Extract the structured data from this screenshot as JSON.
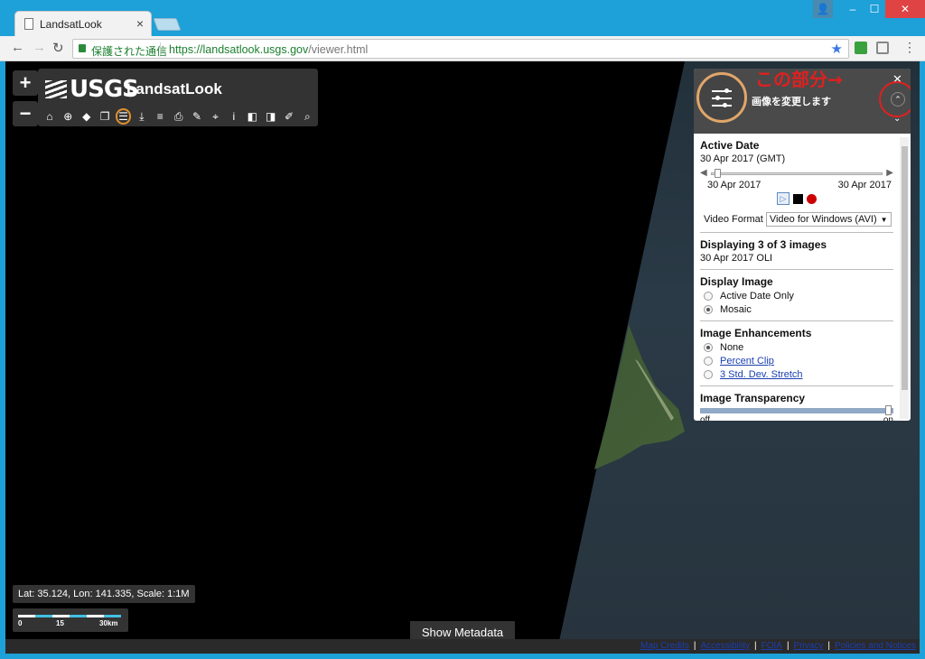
{
  "browser": {
    "tab_title": "LandsatLook",
    "tab_close": "×",
    "secure_label": "保護された通信",
    "url_host": "https://landsatlook.usgs.gov",
    "url_path": "/viewer.html",
    "back": "←",
    "forward": "→",
    "reload": "↻",
    "star": "★",
    "menu": "⋮",
    "win_user": "👤",
    "win_min": "–",
    "win_max": "☐",
    "win_close": "✕"
  },
  "map": {
    "zoom_in": "+",
    "zoom_out": "−",
    "brand": "USGS",
    "app_name": "LandsatLook",
    "tools": [
      "home-icon",
      "target-icon",
      "tag-icon",
      "layers-icon",
      "adjust-icon",
      "download-icon",
      "stack-icon",
      "print-icon",
      "pencil-icon",
      "pin-icon",
      "info-icon",
      "compare-icon",
      "bookmark-icon",
      "edit-icon",
      "search-icon"
    ],
    "tool_glyphs": [
      "⌂",
      "⊕",
      "◆",
      "❐",
      "☰",
      "⤓",
      "≡",
      "⎙",
      "✎",
      "⌖",
      "i",
      "◧",
      "◨",
      "✐",
      "⌕"
    ],
    "coords": "Lat: 35.124, Lon: 141.335, Scale: 1:1M",
    "scale_labels": [
      "0",
      "15",
      "30km"
    ],
    "show_metadata": "Show Metadata",
    "footer_links": [
      "Map Credits",
      "Accessibility",
      "FOIA",
      "Privacy",
      "Policies and Notices"
    ]
  },
  "panel": {
    "title": "画像を変更します",
    "close": "✕",
    "up": "⌃",
    "down": "⌄",
    "annotation": "この部分→",
    "active_date": {
      "heading": "Active Date",
      "value": "30 Apr 2017 (GMT)",
      "range_start": "30 Apr 2017",
      "range_end": "30 Apr 2017",
      "play": "▷",
      "video_label": "Video Format",
      "video_value": "Video for Windows (AVI)",
      "video_caret": "▼"
    },
    "displaying": {
      "heading": "Displaying 3 of 3 images",
      "value": "30 Apr 2017 OLI"
    },
    "display_image": {
      "heading": "Display Image",
      "options": [
        "Active Date Only",
        "Mosaic"
      ],
      "selected": "Mosaic"
    },
    "enhancements": {
      "heading": "Image Enhancements",
      "options": [
        "None",
        "Percent Clip",
        "3 Std. Dev. Stretch"
      ],
      "selected": "None"
    },
    "transparency": {
      "heading": "Image Transparency",
      "min_label": "off",
      "max_label": "on",
      "level": 1.0
    }
  },
  "colors": {
    "title_bar": "#1ea0d8",
    "accent_ring": "#e0a66a",
    "annotation": "#e02020",
    "link": "#1a3fb0"
  }
}
